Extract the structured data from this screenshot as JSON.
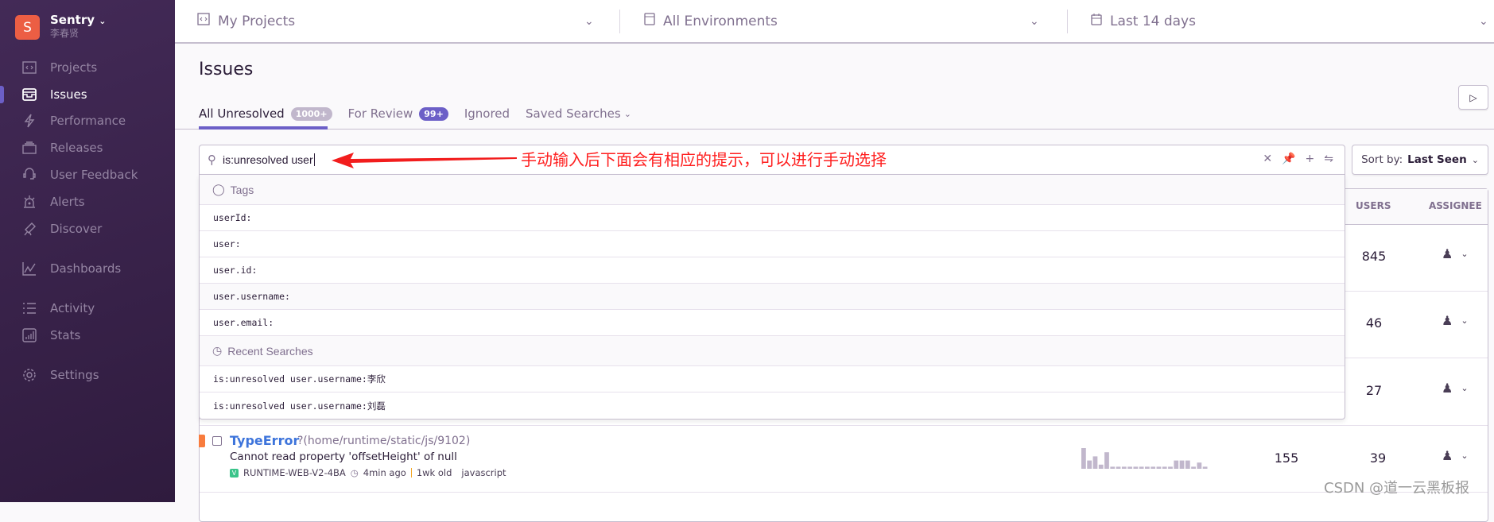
{
  "sidebar": {
    "org_initial": "S",
    "org_name": "Sentry",
    "org_user": "李春贤",
    "items": [
      {
        "label": "Projects",
        "icon": "folder-code-icon"
      },
      {
        "label": "Issues",
        "icon": "inbox-icon",
        "active": true
      },
      {
        "label": "Performance",
        "icon": "lightning-icon"
      },
      {
        "label": "Releases",
        "icon": "package-icon"
      },
      {
        "label": "User Feedback",
        "icon": "megaphone-icon"
      },
      {
        "label": "Alerts",
        "icon": "siren-icon"
      },
      {
        "label": "Discover",
        "icon": "telescope-icon"
      },
      {
        "label": "Dashboards",
        "icon": "line-chart-icon"
      },
      {
        "label": "Activity",
        "icon": "list-icon"
      },
      {
        "label": "Stats",
        "icon": "bar-chart-icon"
      },
      {
        "label": "Settings",
        "icon": "gear-icon"
      }
    ]
  },
  "topbar": {
    "projects": "My Projects",
    "environments": "All Environments",
    "period": "Last 14 days"
  },
  "page": {
    "title": "Issues",
    "tabs": [
      {
        "label": "All Unresolved",
        "badge": "1000+",
        "badge_color": "#c1b7cc"
      },
      {
        "label": "For Review",
        "badge": "99+",
        "badge_color": "#6c5fc7"
      },
      {
        "label": "Ignored"
      },
      {
        "label": "Saved Searches"
      }
    ]
  },
  "search": {
    "value": "is:unresolved user",
    "tags_header": "Tags",
    "tags": [
      "userId:",
      "user:",
      "user.id:",
      "user.username:",
      "user.email:"
    ],
    "recent_header": "Recent Searches",
    "recent": [
      "is:unresolved user.username:李欣",
      "is:unresolved user.username:刘磊"
    ]
  },
  "sort": {
    "label": "Sort by:",
    "value": "Last Seen"
  },
  "table": {
    "columns": {
      "users": "USERS",
      "assignee": "ASSIGNEE"
    },
    "rows": [
      {
        "users": "845"
      },
      {
        "users": "46"
      },
      {
        "users": "27"
      },
      {
        "title": "TypeError",
        "location": "?(home/runtime/static/js/9102)",
        "message": "Cannot read property 'offsetHeight' of null",
        "short_id": "RUNTIME-WEB-V2-4BA",
        "last_seen": "4min ago",
        "first_seen": "1wk old",
        "platform": "javascript",
        "level_color": "#f87c3e",
        "events": "155",
        "users": "39",
        "sparkline": [
          10,
          4,
          6,
          2,
          8,
          1,
          1,
          1,
          1,
          1,
          1,
          1,
          1,
          1,
          1,
          1,
          4,
          4,
          4,
          1,
          3,
          1
        ]
      }
    ]
  },
  "annotation": "手动输入后下面会有相应的提示，可以进行手动选择",
  "watermark": "CSDN @道一云黑板报"
}
